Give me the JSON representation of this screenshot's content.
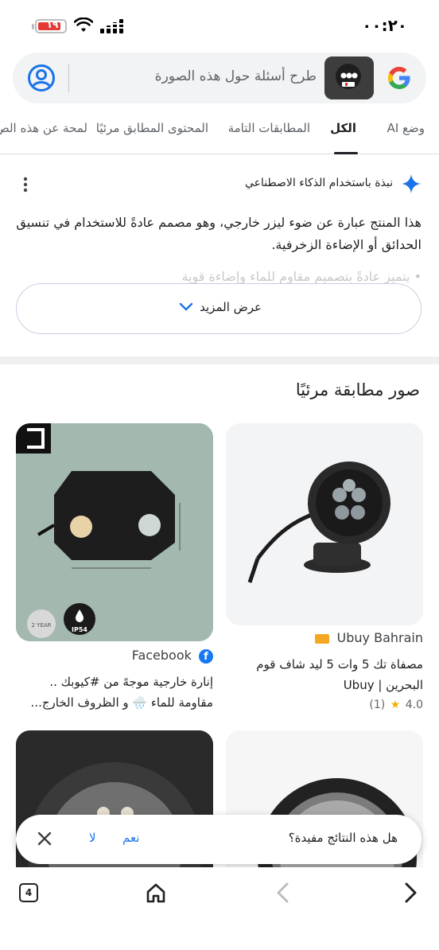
{
  "status": {
    "time": "٠٠:٢٠",
    "battery": "١٩",
    "battery_color": "#e53935"
  },
  "search": {
    "placeholder": "طرح أسئلة حول هذه الصورة"
  },
  "tabs": {
    "ai_mode": "وضع AI",
    "all": "الكل",
    "exact": "المطابقات التامة",
    "visual": "المحتوى المطابق مرئيًا",
    "about": "لمحة عن هذه الص"
  },
  "ai_overview": {
    "title": "نبذة باستخدام الذكاء الاصطناعي",
    "body": "هذا المنتج عبارة عن ضوء ليزر خارجي، وهو مصمم عادةً للاستخدام في تنسيق الحدائق أو الإضاءة الزخرفية.",
    "faded_line": "• يتميز عادةً بتصميم مقاوم للماء وإضاءة قوية",
    "show_more": "عرض المزيد",
    "accent": "#1a73e8"
  },
  "visual_matches": {
    "title": "صور مطابقة مرئيًا",
    "cards": [
      {
        "source": "Ubuy Bahrain",
        "title": "مصفاة تك 5 وات 5 ليد شاف قوم البحرين | Ubuy",
        "rating": "4.0",
        "rating_count": "(1)"
      },
      {
        "source": "Facebook",
        "title": "إنارة خارجية موجهً من #كيوبك .. مقاومة للماء 🌧️ و الظروف الخارج...",
        "badge": "IP54",
        "logo_badge": "2 YEAR"
      }
    ]
  },
  "feedback": {
    "question": "هل هذه النتائج مفيدة؟",
    "yes": "نعم",
    "no": "لا"
  },
  "nav": {
    "tab_count": "4"
  }
}
